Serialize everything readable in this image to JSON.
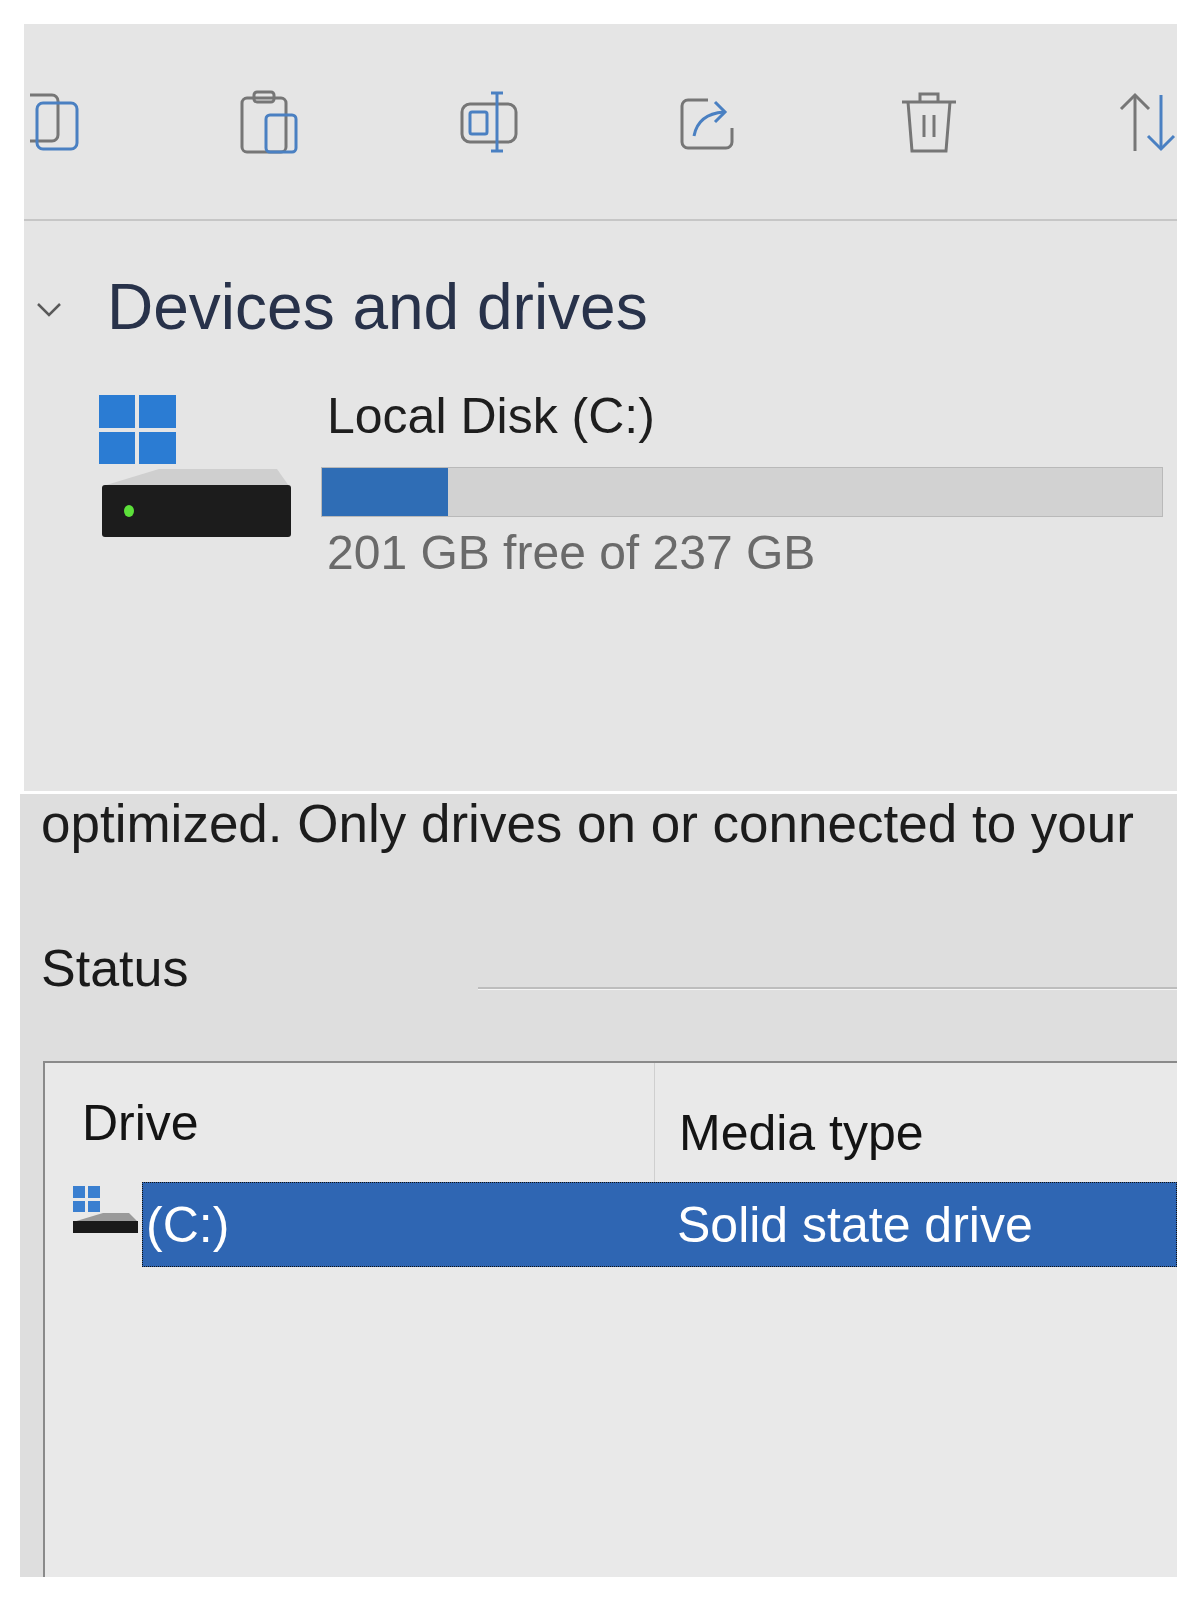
{
  "section": {
    "title": "Devices and drives",
    "expanded": true,
    "drives": [
      {
        "name": "Local Disk (C:)",
        "level": 0.15,
        "reading": "201 GB free of 237 GB"
      }
    ]
  },
  "description": "optimized. Only drives on or connected to your",
  "status_group": {
    "label": "Status",
    "table": {
      "columns": [
        "Drive",
        "Media type"
      ],
      "rows": [
        {
          "cells": [
            "(C:)",
            "Solid state drive"
          ],
          "selected": true
        }
      ]
    }
  }
}
